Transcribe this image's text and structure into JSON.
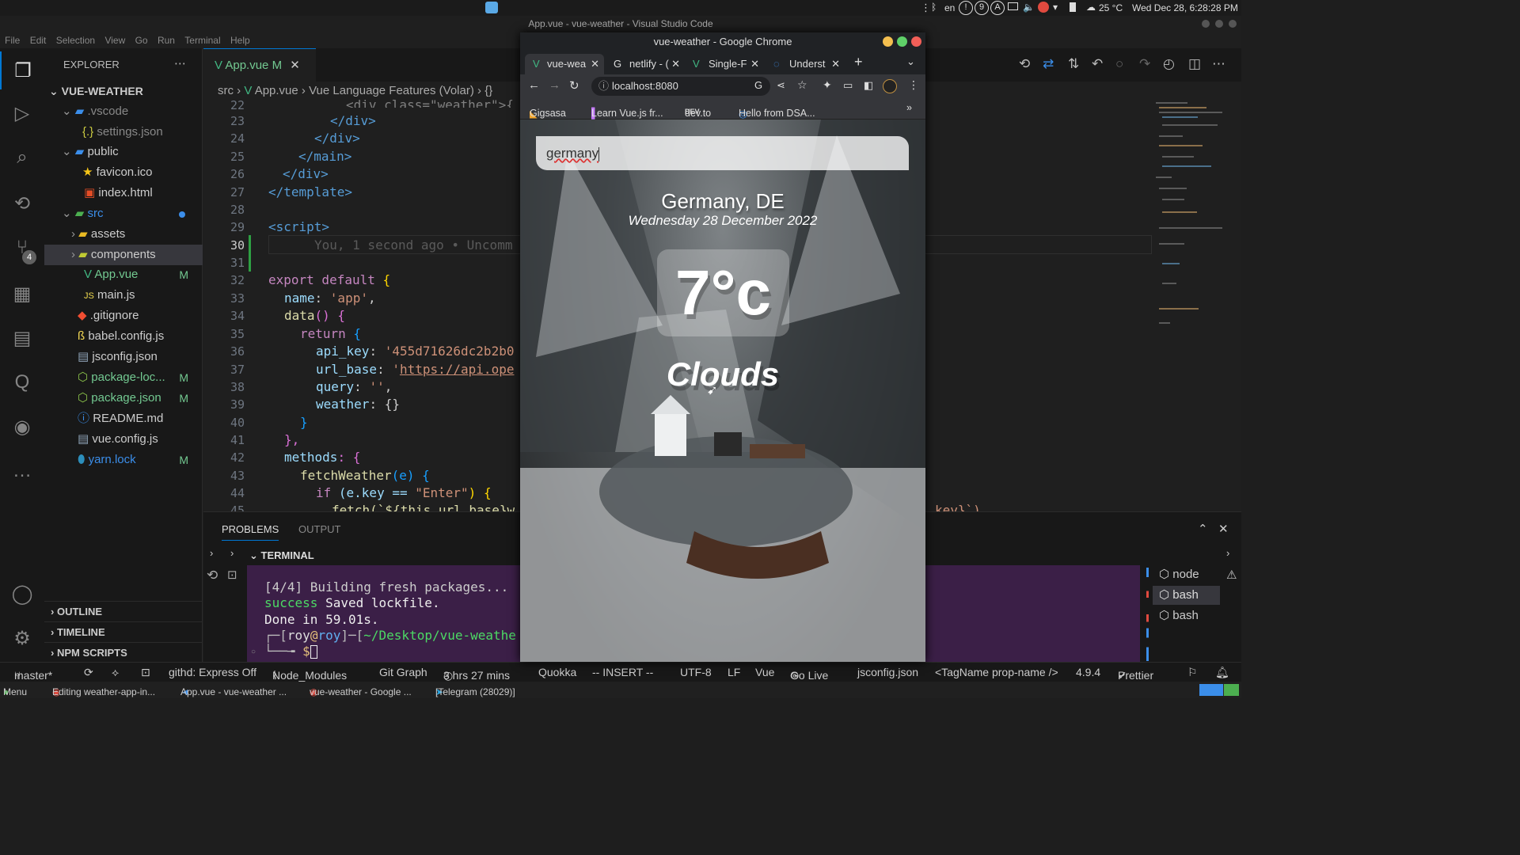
{
  "system": {
    "lang": "en",
    "weather": "25 °C",
    "clock": "Wed Dec 28, 6:28:28 PM",
    "badges": [
      "!",
      "9",
      "A"
    ]
  },
  "window_title": "App.vue - vue-weather - Visual Studio Code",
  "menu": [
    "File",
    "Edit",
    "Selection",
    "View",
    "Go",
    "Run",
    "Terminal",
    "Help"
  ],
  "explorer": {
    "header": "EXPLORER",
    "root": "VUE-WEATHER",
    "scm_badge": "4",
    "items": [
      {
        "label": ".vscode",
        "status": ""
      },
      {
        "label": "settings.json",
        "status": ""
      },
      {
        "label": "public",
        "status": ""
      },
      {
        "label": "favicon.ico",
        "status": ""
      },
      {
        "label": "index.html",
        "status": ""
      },
      {
        "label": "src",
        "status": ""
      },
      {
        "label": "assets",
        "status": ""
      },
      {
        "label": "components",
        "status": ""
      },
      {
        "label": "App.vue",
        "status": "M"
      },
      {
        "label": "main.js",
        "status": ""
      },
      {
        "label": ".gitignore",
        "status": ""
      },
      {
        "label": "babel.config.js",
        "status": ""
      },
      {
        "label": "jsconfig.json",
        "status": ""
      },
      {
        "label": "package-loc...",
        "status": "M"
      },
      {
        "label": "package.json",
        "status": "M"
      },
      {
        "label": "README.md",
        "status": ""
      },
      {
        "label": "vue.config.js",
        "status": ""
      },
      {
        "label": "yarn.lock",
        "status": "M"
      }
    ],
    "sections": [
      "OUTLINE",
      "TIMELINE",
      "NPM SCRIPTS"
    ]
  },
  "editor_tab": {
    "label": "App.vue",
    "status": "M"
  },
  "breadcrumb": [
    "src",
    "App.vue",
    "Vue Language Features (Volar)",
    "{}"
  ],
  "line_numbers": [
    "22",
    "23",
    "24",
    "25",
    "26",
    "27",
    "28",
    "29",
    "30",
    "31",
    "32",
    "33",
    "34",
    "35",
    "36",
    "37",
    "38",
    "39",
    "40",
    "41",
    "42",
    "43",
    "44",
    "45"
  ],
  "code": {
    "l22": "<div class=\"weather\">{",
    "l23": "</div>",
    "l24": "</div>",
    "l25": "</main>",
    "l26": "</div>",
    "l27": "</template>",
    "l29": "<script>",
    "l30": "You, 1 second ago • Uncomm",
    "l32a": "export default",
    "l32b": " {",
    "l33a": "name",
    "l33b": ": ",
    "l33c": "'app'",
    "l33d": ",",
    "l34a": "data",
    "l34b": "() {",
    "l35a": "return",
    "l35b": " {",
    "l36a": "api_key",
    "l36b": ": ",
    "l36c": "'455d71626dc2b2b0",
    "l37a": "url_base",
    "l37b": ": ",
    "l37c": "'",
    "l37d": "https://api.ope",
    "l38a": "query",
    "l38b": ": ",
    "l38c": "''",
    "l38d": ",",
    "l39a": "weather",
    "l39b": ": {}",
    "l40": "}",
    "l41": "},",
    "l42a": "methods",
    "l42b": ": {",
    "l43a": "fetchWeather",
    "l43b": "(e) {",
    "l44a": "if",
    "l44b": " (e.key == ",
    "l44c": "\"Enter\"",
    "l44d": ") {",
    "l45": "fetch(`${this.url_base}w",
    "l45r": "key}`)"
  },
  "panel": {
    "tabs": [
      "PROBLEMS",
      "OUTPUT"
    ],
    "terminal_label": "TERMINAL",
    "terminal_lines": [
      "[4/4] Building fresh packages...",
      "success",
      "Saved lockfile.",
      "Done in 59.01s.",
      "┌─[",
      "roy",
      "@",
      "roy",
      "]─[",
      "~/Desktop/vue-weathe",
      "└──╼ ",
      "$"
    ],
    "instances": [
      "node",
      "bash",
      "bash"
    ]
  },
  "status_bar": [
    "master*",
    "githd: Express Off",
    "Node_Modules",
    "Git Graph",
    "3 hrs 27 mins",
    "Quokka",
    "-- INSERT --",
    "UTF-8",
    "LF",
    "Vue",
    "Go Live",
    "jsconfig.json",
    "<TagName prop-name />",
    "4.9.4",
    "Prettier"
  ],
  "taskbar": [
    "Menu",
    "Editing weather-app-in...",
    "App.vue - vue-weather ...",
    "vue-weather - Google ...",
    "[Telegram (28029)]"
  ],
  "chrome": {
    "title": "vue-weather - Google Chrome",
    "tabs": [
      "vue-wea",
      "netlify - (",
      "Single-F",
      "Underst"
    ],
    "url": "localhost:8080",
    "bookmarks": [
      "Gigsasa",
      "Learn Vue.js fr...",
      "dev.to",
      "Hello from DSA..."
    ],
    "app": {
      "query": "germany",
      "location": "Germany, DE",
      "date": "Wednesday 28 December 2022",
      "temp": "7°c",
      "weather": "Clouds"
    }
  },
  "colors": {
    "accent": "#0078d4",
    "modified": "#73c991",
    "terminal_bg": "#3b1f47"
  }
}
